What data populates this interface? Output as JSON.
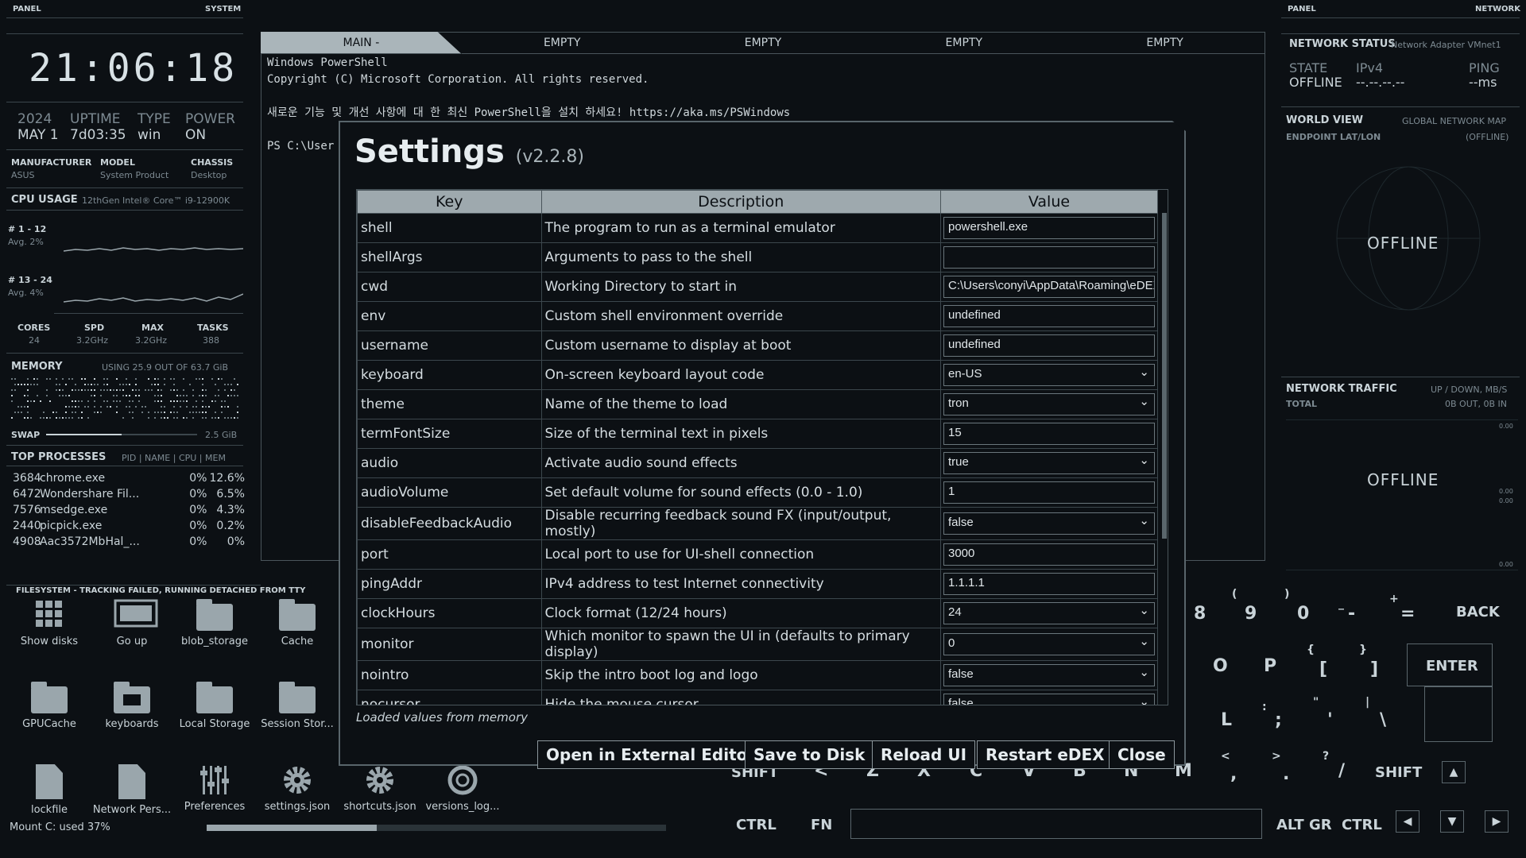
{
  "left_panel": {
    "header_left": "PANEL",
    "header_right": "SYSTEM",
    "clock": "21:06:18",
    "year": "2024",
    "date": "MAY 1",
    "uptime_label": "UPTIME",
    "uptime_value": "7d03:35",
    "type_label": "TYPE",
    "type_value": "win",
    "power_label": "POWER",
    "power_value": "ON",
    "manufacturer_label": "MANUFACTURER",
    "manufacturer_value": "ASUS",
    "model_label": "MODEL",
    "model_value": "System Product",
    "chassis_label": "CHASSIS",
    "chassis_value": "Desktop",
    "cpu_label": "CPU USAGE",
    "cpu_name": "12thGen Intel® Core™ i9-12900K",
    "cpu_group1": "# 1 - 12",
    "cpu_group1_avg": "Avg. 2%",
    "cpu_group2": "# 13 - 24",
    "cpu_group2_avg": "Avg. 4%",
    "cores_label": "CORES",
    "cores_value": "24",
    "spd_label": "SPD",
    "spd_value": "3.2GHz",
    "max_label": "MAX",
    "max_value": "3.2GHz",
    "tasks_label": "TASKS",
    "tasks_value": "388",
    "memory_label": "MEMORY",
    "memory_usage": "USING 25.9 OUT OF 63.7 GiB",
    "swap_label": "SWAP",
    "swap_value": "2.5 GiB",
    "swap_fraction": 0.5,
    "top_label": "TOP PROCESSES",
    "top_columns": "PID | NAME | CPU | MEM",
    "processes": [
      {
        "pid": "3684",
        "name": "chrome.exe",
        "cpu": "0%",
        "mem": "12.6%"
      },
      {
        "pid": "6472",
        "name": "Wondershare Fil...",
        "cpu": "0%",
        "mem": "6.5%"
      },
      {
        "pid": "7576",
        "name": "msedge.exe",
        "cpu": "0%",
        "mem": "4.3%"
      },
      {
        "pid": "2440",
        "name": "picpick.exe",
        "cpu": "0%",
        "mem": "0.2%"
      },
      {
        "pid": "4908",
        "name": "Aac3572MbHal_...",
        "cpu": "0%",
        "mem": "0%"
      }
    ]
  },
  "filesystem": {
    "header": "FILESYSTEM - TRACKING FAILED, RUNNING DETACHED FROM TTY",
    "items": [
      {
        "label": "Show disks",
        "icon": "grid-icon"
      },
      {
        "label": "Go up",
        "icon": "go-up-icon"
      },
      {
        "label": "blob_storage",
        "icon": "folder-icon"
      },
      {
        "label": "Cache",
        "icon": "folder-icon"
      },
      {
        "label": "GPUCache",
        "icon": "folder-icon"
      },
      {
        "label": "keyboards",
        "icon": "keyboard-folder-icon"
      },
      {
        "label": "Local Storage",
        "icon": "folder-icon"
      },
      {
        "label": "Session Stor...",
        "icon": "folder-icon"
      },
      {
        "label": "lockfile",
        "icon": "file-icon"
      },
      {
        "label": "Network Pers...",
        "icon": "file-icon"
      },
      {
        "label": "Preferences",
        "icon": "sliders-icon"
      },
      {
        "label": "settings.json",
        "icon": "gear-icon"
      },
      {
        "label": "shortcuts.json",
        "icon": "gear-icon"
      },
      {
        "label": "versions_log...",
        "icon": "logo-icon"
      }
    ],
    "mount": "Mount C: used 37%",
    "mount_fraction": 0.37
  },
  "terminal": {
    "tabs": [
      "MAIN -",
      "EMPTY",
      "EMPTY",
      "EMPTY",
      "EMPTY"
    ],
    "line1": "Windows PowerShell",
    "line2": "Copyright (C) Microsoft Corporation. All rights reserved.",
    "line3": "새로운 기능 및 개선 사항에 대 한 최신 PowerShell을 설치 하세요! https://aka.ms/PSWindows",
    "line4": "PS C:\\User"
  },
  "right_panel": {
    "header_left": "PANEL",
    "header_right": "NETWORK",
    "status_label": "NETWORK STATUS",
    "adapter": "Network Adapter VMnet1",
    "state_label": "STATE",
    "state_value": "OFFLINE",
    "ipv4_label": "IPv4",
    "ipv4_value": "--.--.--.--",
    "ping_label": "PING",
    "ping_value": "--ms",
    "world_label": "WORLD VIEW",
    "world_right": "GLOBAL NETWORK MAP",
    "endpoint_label": "ENDPOINT LAT/LON",
    "endpoint_value": "(OFFLINE)",
    "globe_status": "OFFLINE",
    "traffic_label": "NETWORK TRAFFIC",
    "traffic_right": "UP / DOWN, MB/S",
    "total_label": "TOTAL",
    "total_value": "0B OUT, 0B IN",
    "traffic_status": "OFFLINE",
    "axis_ticks": [
      "0.00",
      "0.00",
      "0.00",
      "0.00",
      "0.00"
    ]
  },
  "keyboard": {
    "keys": [
      "8",
      "9",
      "0",
      "-",
      "=",
      "BACK",
      "O",
      "P",
      "[",
      "]",
      "ENTER",
      "L",
      ";",
      "'",
      "\\",
      ",",
      ".",
      "/",
      "SHIFT",
      "SHIFT",
      "<",
      "Z",
      "X",
      "C",
      "V",
      "B",
      "N",
      "M",
      "CTRL",
      "FN",
      "ALT GR",
      "CTRL"
    ],
    "shift_chars": [
      "(",
      ")",
      "_",
      "+",
      "{",
      "}",
      ":",
      "\"",
      "|",
      "<",
      ">",
      "?"
    ]
  },
  "settings": {
    "title": "Settings",
    "version": "(v2.2.8)",
    "columns": [
      "Key",
      "Description",
      "Value"
    ],
    "rows": [
      {
        "key": "shell",
        "desc": "The program to run as a terminal emulator",
        "value": "powershell.exe",
        "select": false
      },
      {
        "key": "shellArgs",
        "desc": "Arguments to pass to the shell",
        "value": "",
        "select": false
      },
      {
        "key": "cwd",
        "desc": "Working Directory to start in",
        "value": "C:\\Users\\conyi\\AppData\\Roaming\\eDEX",
        "select": false
      },
      {
        "key": "env",
        "desc": "Custom shell environment override",
        "value": "undefined",
        "select": false
      },
      {
        "key": "username",
        "desc": "Custom username to display at boot",
        "value": "undefined",
        "select": false
      },
      {
        "key": "keyboard",
        "desc": "On-screen keyboard layout code",
        "value": "en-US",
        "select": true
      },
      {
        "key": "theme",
        "desc": "Name of the theme to load",
        "value": "tron",
        "select": true
      },
      {
        "key": "termFontSize",
        "desc": "Size of the terminal text in pixels",
        "value": "15",
        "select": false
      },
      {
        "key": "audio",
        "desc": "Activate audio sound effects",
        "value": "true",
        "select": true
      },
      {
        "key": "audioVolume",
        "desc": "Set default volume for sound effects (0.0 - 1.0)",
        "value": "1",
        "select": false
      },
      {
        "key": "disableFeedbackAudio",
        "desc": "Disable recurring feedback sound FX (input/output, mostly)",
        "value": "false",
        "select": true
      },
      {
        "key": "port",
        "desc": "Local port to use for UI-shell connection",
        "value": "3000",
        "select": false
      },
      {
        "key": "pingAddr",
        "desc": "IPv4 address to test Internet connectivity",
        "value": "1.1.1.1",
        "select": false
      },
      {
        "key": "clockHours",
        "desc": "Clock format (12/24 hours)",
        "value": "24",
        "select": true
      },
      {
        "key": "monitor",
        "desc": "Which monitor to spawn the UI in (defaults to primary display)",
        "value": "0",
        "select": true
      },
      {
        "key": "nointro",
        "desc": "Skip the intro boot log and logo",
        "value": "false",
        "select": true
      },
      {
        "key": "nocursor",
        "desc": "Hide the mouse cursor",
        "value": "false",
        "select": true
      }
    ],
    "loaded_note": "Loaded values from memory",
    "buttons": {
      "external": "Open in External Editor",
      "save": "Save to Disk",
      "reload": "Reload UI",
      "restart": "Restart eDEX",
      "close": "Close"
    }
  }
}
